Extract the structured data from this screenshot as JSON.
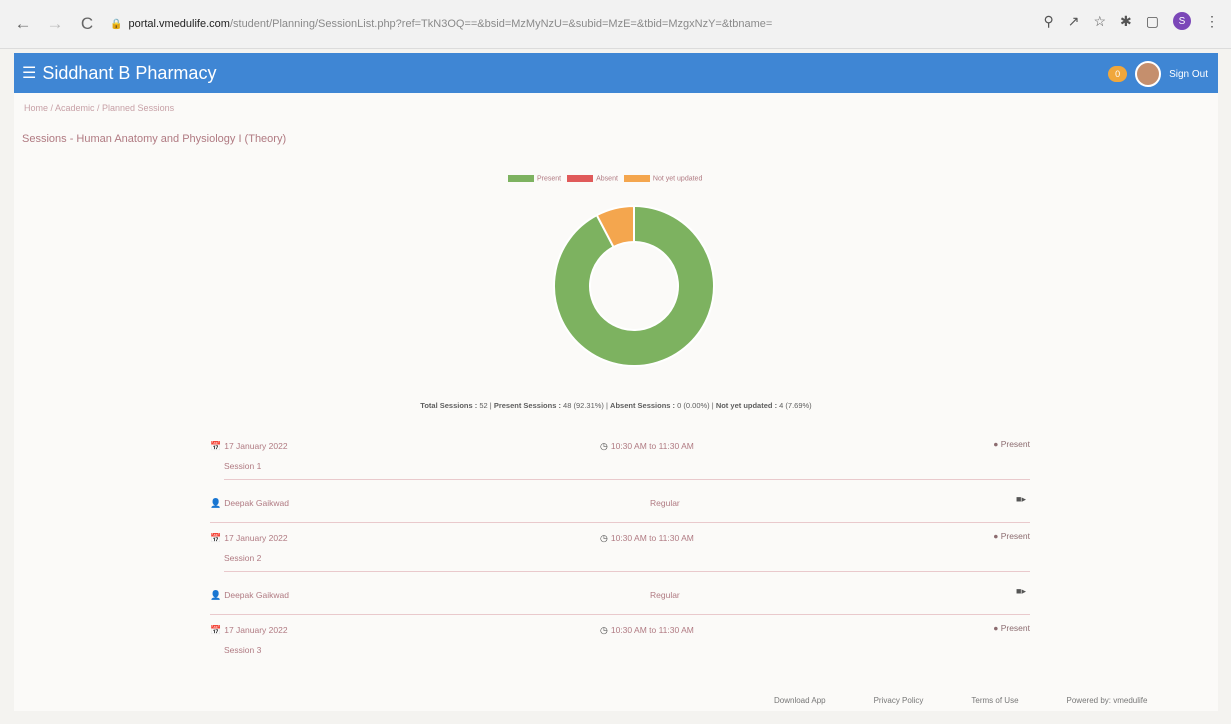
{
  "browser": {
    "host": "portal.vmedulife.com",
    "path": "/student/Planning/SessionList.php?ref=TkN3OQ==&bsid=MzMyNzU=&subid=MzE=&tbid=MzgxNzY=&tbname=",
    "nav": {
      "back": "←",
      "forward": "→",
      "reload": "C"
    },
    "profile_initial": "S"
  },
  "header": {
    "app_title": "Siddhant B Pharmacy",
    "pill": "0",
    "user_link": "Sign Out"
  },
  "breadcrumb": "Home / Academic / Planned Sessions",
  "page_title": "Sessions - Human Anatomy and Physiology I (Theory)",
  "legend": [
    "Present",
    "Absent",
    "Not yet updated"
  ],
  "colors": {
    "present": "#7db260",
    "absent": "#e05a5a",
    "not_updated": "#f4a64e",
    "header": "#3f86d4"
  },
  "chart_data": {
    "type": "pie",
    "variant": "doughnut",
    "categories": [
      "Present",
      "Absent",
      "Not yet updated"
    ],
    "values": [
      48,
      0,
      4
    ],
    "legend_position": "top"
  },
  "summary": {
    "total_label": "Total Sessions :",
    "total": "52",
    "present_label": "Present Sessions :",
    "present": "48 (92.31%)",
    "absent_label": "Absent Sessions :",
    "absent": "0 (0.00%)",
    "not_updated_label": "Not yet updated :",
    "not_updated": "4 (7.69%)"
  },
  "sessions": [
    {
      "date": "17 January 2022",
      "time": "10:30 AM to 11:30 AM",
      "status": "Present",
      "name": "Session 1",
      "teacher": "Deepak Gaikwad",
      "role": "Regular"
    },
    {
      "date": "17 January 2022",
      "time": "10:30 AM to 11:30 AM",
      "status": "Present",
      "name": "Session 2",
      "teacher": "Deepak Gaikwad",
      "role": "Regular"
    },
    {
      "date": "17 January 2022",
      "time": "10:30 AM to 11:30 AM",
      "status": "Present",
      "name": "Session 3"
    }
  ],
  "footer": [
    "Download App",
    "Privacy Policy",
    "Terms of Use",
    "Powered by: vmedulife"
  ]
}
